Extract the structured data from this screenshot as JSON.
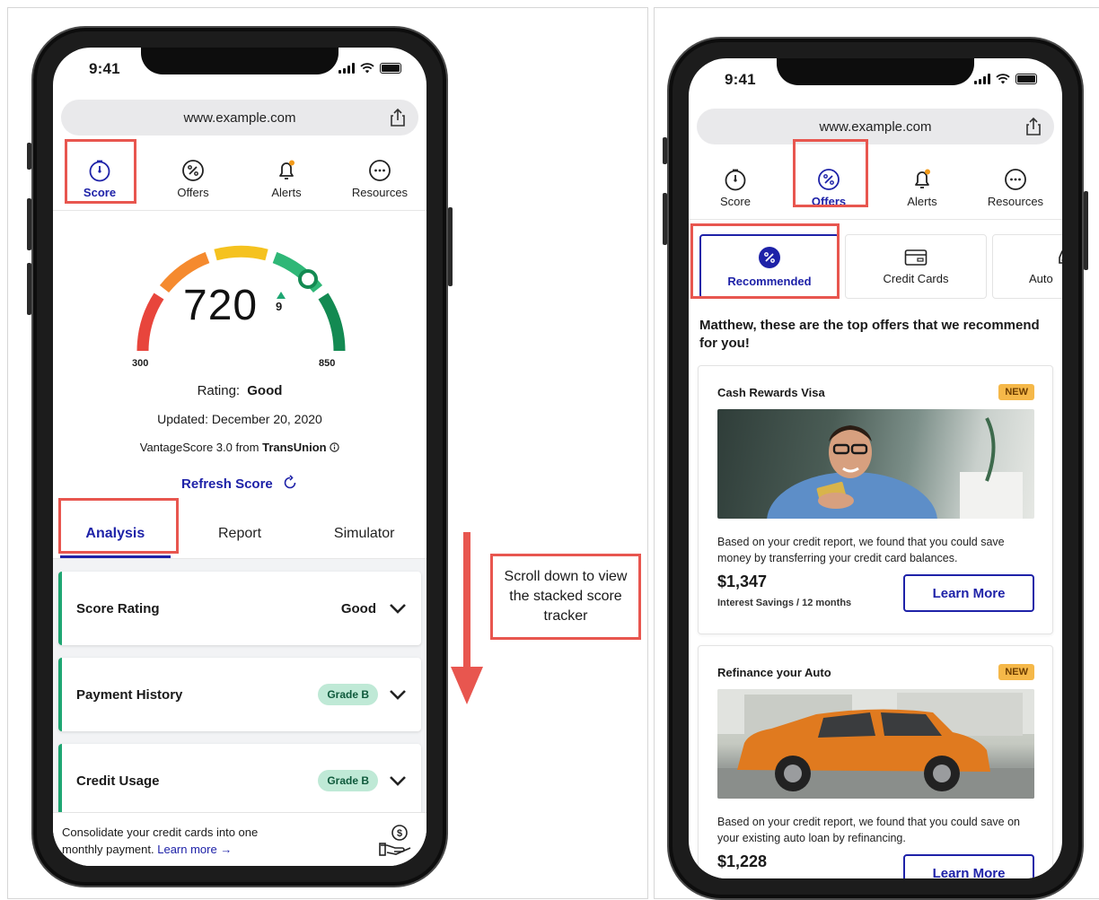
{
  "left_phone": {
    "status_time": "9:41",
    "url": "www.example.com",
    "nav": [
      {
        "label": "Score",
        "icon": "gauge-icon",
        "active": true
      },
      {
        "label": "Offers",
        "icon": "percent-icon",
        "active": false
      },
      {
        "label": "Alerts",
        "icon": "bell-icon",
        "active": false
      },
      {
        "label": "Resources",
        "icon": "more-icon",
        "active": false
      }
    ],
    "score": {
      "value": "720",
      "change": "9",
      "min_label": "300",
      "max_label": "850",
      "rating_label": "Rating:",
      "rating_value": "Good",
      "updated": "Updated: December 20, 2020",
      "source_prefix": "VantageScore 3.0 from ",
      "source_name": "TransUnion",
      "refresh_label": "Refresh Score"
    },
    "tabs": [
      "Analysis",
      "Report",
      "Simulator"
    ],
    "factors": [
      {
        "title": "Score Rating",
        "value": "Good"
      },
      {
        "title": "Payment History",
        "grade": "Grade B"
      },
      {
        "title": "Credit Usage",
        "grade": "Grade B"
      }
    ],
    "banner": {
      "text": "Consolidate your credit cards into one monthly payment.",
      "link": "Learn more"
    }
  },
  "annotation": {
    "callout": "Scroll down to view the stacked score tracker"
  },
  "right_phone": {
    "status_time": "9:41",
    "url": "www.example.com",
    "nav": [
      {
        "label": "Score",
        "icon": "gauge-icon",
        "active": false
      },
      {
        "label": "Offers",
        "icon": "percent-icon",
        "active": true
      },
      {
        "label": "Alerts",
        "icon": "bell-icon",
        "active": false
      },
      {
        "label": "Resources",
        "icon": "more-icon",
        "active": false
      }
    ],
    "subtabs": [
      {
        "label": "Recommended",
        "icon": "percent-badge-icon",
        "active": true
      },
      {
        "label": "Credit Cards",
        "icon": "card-icon",
        "active": false
      },
      {
        "label": "Auto",
        "icon": "car-icon",
        "active": false
      }
    ],
    "heading": "Matthew, these are the top offers that we recommend for you!",
    "offers": [
      {
        "title": "Cash Rewards Visa",
        "badge": "NEW",
        "description": "Based on your credit report, we found that you could save money by transferring your credit card balances.",
        "amount": "$1,347",
        "amount_label": "Interest Savings / 12 months",
        "button": "Learn More"
      },
      {
        "title": "Refinance your Auto",
        "badge": "NEW",
        "description": "Based on your credit report, we found that you could save on your existing auto loan by refinancing.",
        "amount": "$1,228",
        "button": "Learn More"
      }
    ]
  },
  "colors": {
    "accent": "#1e22a8",
    "highlight": "#e8564f",
    "grade_bg": "#bfe9d6",
    "badge_bg": "#f5b849",
    "good_green": "#1ea672"
  }
}
